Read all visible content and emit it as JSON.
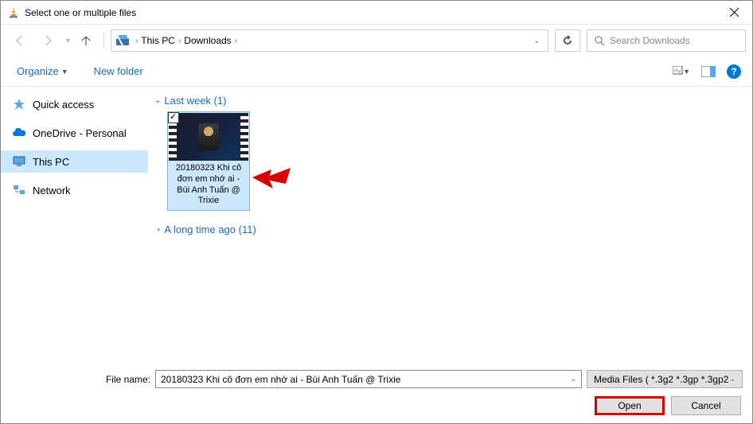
{
  "title": "Select one or multiple files",
  "breadcrumb": {
    "root": "This PC",
    "folder": "Downloads"
  },
  "search": {
    "placeholder": "Search Downloads"
  },
  "toolbar": {
    "organize": "Organize",
    "new_folder": "New folder"
  },
  "sidebar": {
    "items": [
      {
        "label": "Quick access"
      },
      {
        "label": "OneDrive - Personal"
      },
      {
        "label": "This PC"
      },
      {
        "label": "Network"
      }
    ]
  },
  "groups": {
    "g1": {
      "label": "Last week (1)"
    },
    "g2": {
      "label": "A long time ago (11)"
    }
  },
  "file": {
    "name": "20180323 Khi cô đơn em nhớ ai - Bùi Anh Tuấn @ Trixie"
  },
  "footer": {
    "filename_label": "File name:",
    "filename_value": "20180323 Khi cô đơn em nhớ ai - Bùi Anh Tuấn @ Trixie",
    "filter": "Media Files ( *.3g2 *.3gp *.3gp2",
    "open": "Open",
    "cancel": "Cancel"
  }
}
